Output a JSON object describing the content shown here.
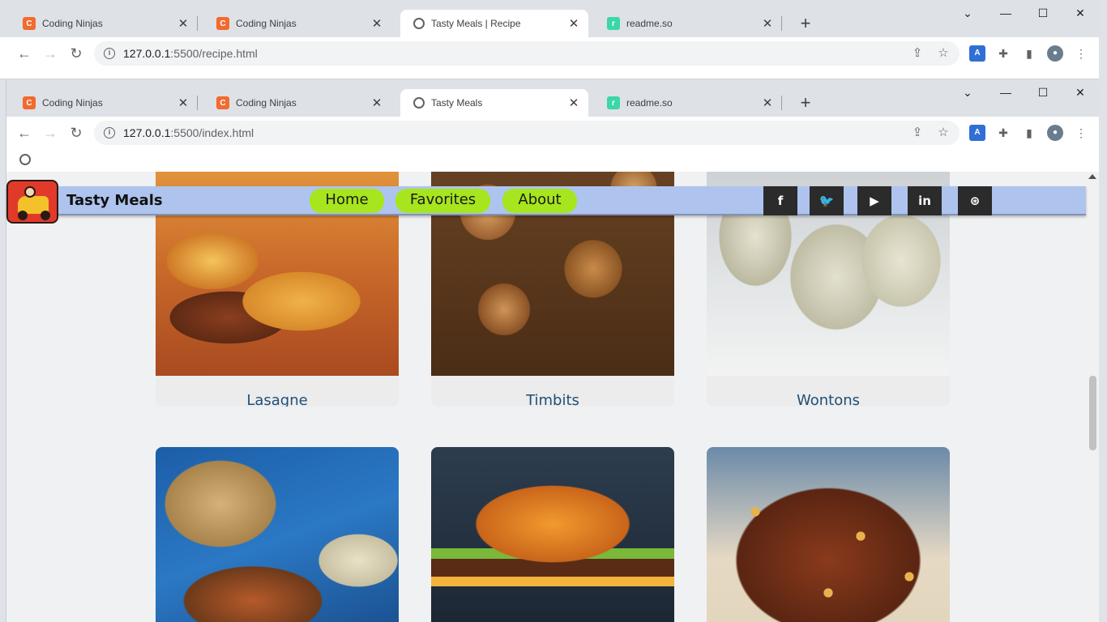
{
  "back_window": {
    "tabs": [
      {
        "title": "Coding Ninjas",
        "icon": "coding-ninjas-favicon"
      },
      {
        "title": "Coding Ninjas",
        "icon": "coding-ninjas-favicon"
      },
      {
        "title": "Tasty Meals | Recipe",
        "icon": "globe-icon"
      },
      {
        "title": "readme.so",
        "icon": "readme-favicon"
      }
    ],
    "url_host": "127.0.0.1",
    "url_rest": ":5500/recipe.html"
  },
  "front_window": {
    "tabs": [
      {
        "title": "Coding Ninjas",
        "icon": "coding-ninjas-favicon"
      },
      {
        "title": "Coding Ninjas",
        "icon": "coding-ninjas-favicon"
      },
      {
        "title": "Tasty Meals",
        "icon": "globe-icon"
      },
      {
        "title": "readme.so",
        "icon": "readme-favicon"
      }
    ],
    "url_host": "127.0.0.1",
    "url_rest": ":5500/index.html"
  },
  "site": {
    "brand": "Tasty Meals",
    "nav": [
      "Home",
      "Favorites",
      "About"
    ],
    "social": [
      "f",
      "t",
      "yt",
      "in",
      "gh"
    ],
    "colors": {
      "header_bg": "#aec4ee",
      "nav_pill": "#a7e51e",
      "card_title": "#1e4f7a"
    }
  },
  "meals": [
    {
      "name": "Lasagne"
    },
    {
      "name": "Timbits"
    },
    {
      "name": "Wontons"
    },
    {
      "name": ""
    },
    {
      "name": ""
    },
    {
      "name": ""
    }
  ]
}
